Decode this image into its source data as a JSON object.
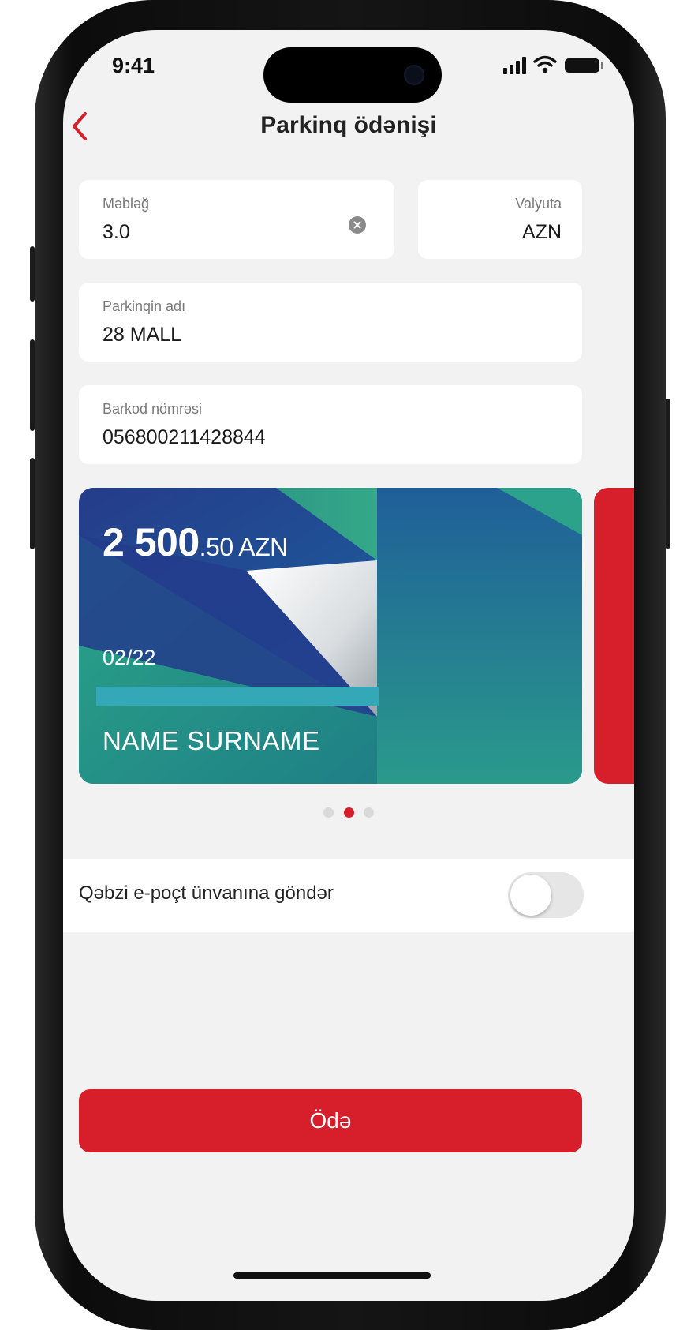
{
  "status": {
    "time": "9:41"
  },
  "header": {
    "title": "Parkinq ödənişi"
  },
  "form": {
    "amount": {
      "label": "Məbləğ",
      "value": "3.0"
    },
    "currency": {
      "label": "Valyuta",
      "value": "AZN"
    },
    "parking_name": {
      "label": "Parkinqin adı",
      "value": "28 MALL"
    },
    "barcode": {
      "label": "Barkod nömrəsi",
      "value": "056800211428844"
    }
  },
  "card": {
    "balance_main": "2 500",
    "balance_decimal": ".50 AZN",
    "expiry": "02/22",
    "holder": "NAME SURNAME"
  },
  "carousel": {
    "count": 3,
    "active_index": 1
  },
  "email_receipt": {
    "label": "Qəbzi e-poçt ünvanına göndər",
    "enabled": false
  },
  "pay_button": {
    "label": "Ödə"
  },
  "colors": {
    "accent": "#d61f2b",
    "background": "#f2f2f2"
  },
  "icons": [
    "back-chevron-icon",
    "clear-icon",
    "signal-icon",
    "wifi-icon",
    "battery-icon"
  ]
}
